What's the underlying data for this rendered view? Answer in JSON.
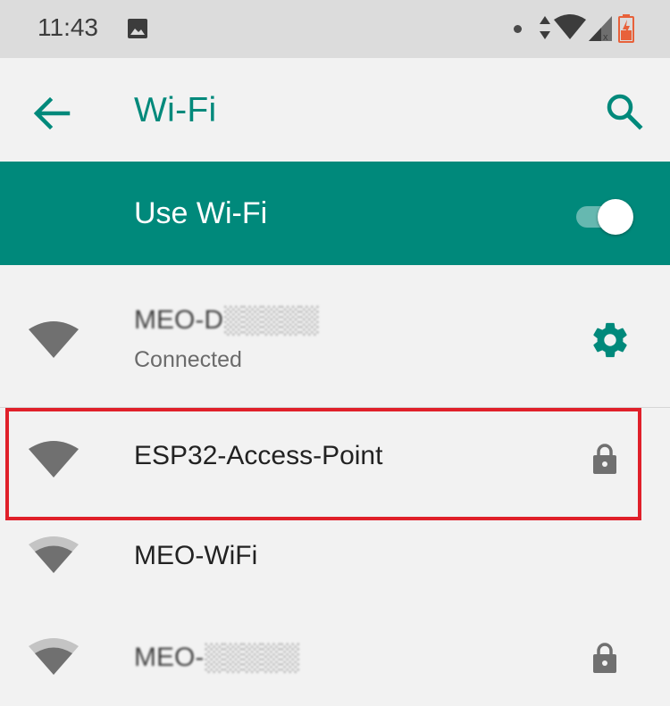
{
  "status_bar": {
    "time": "11:43",
    "icons": [
      "image-icon",
      "dot-icon",
      "data-updown-icon",
      "wifi-signal-icon",
      "cell-signal-icon",
      "battery-charging-icon"
    ],
    "battery_color": "#e8613a"
  },
  "app_bar": {
    "title": "Wi-Fi",
    "back_icon": "arrow-back-icon",
    "search_icon": "search-icon",
    "accent": "#00897b"
  },
  "master_switch": {
    "label": "Use Wi-Fi",
    "enabled": true,
    "background": "#00897b"
  },
  "networks": [
    {
      "name": "MEO-D░░░░░",
      "status": "Connected",
      "signal": "full",
      "trailing_icon": "gear-icon",
      "secured": false,
      "name_obscured": true
    },
    {
      "name": "ESP32-Access-Point",
      "status": "",
      "signal": "full",
      "trailing_icon": "lock-icon",
      "secured": true,
      "highlighted": true,
      "name_obscured": false
    },
    {
      "name": "MEO-WiFi",
      "status": "",
      "signal": "medium",
      "trailing_icon": "",
      "secured": false,
      "name_obscured": false
    },
    {
      "name": "MEO-░░░░░",
      "status": "",
      "signal": "medium",
      "trailing_icon": "lock-icon",
      "secured": true,
      "name_obscured": true
    }
  ]
}
